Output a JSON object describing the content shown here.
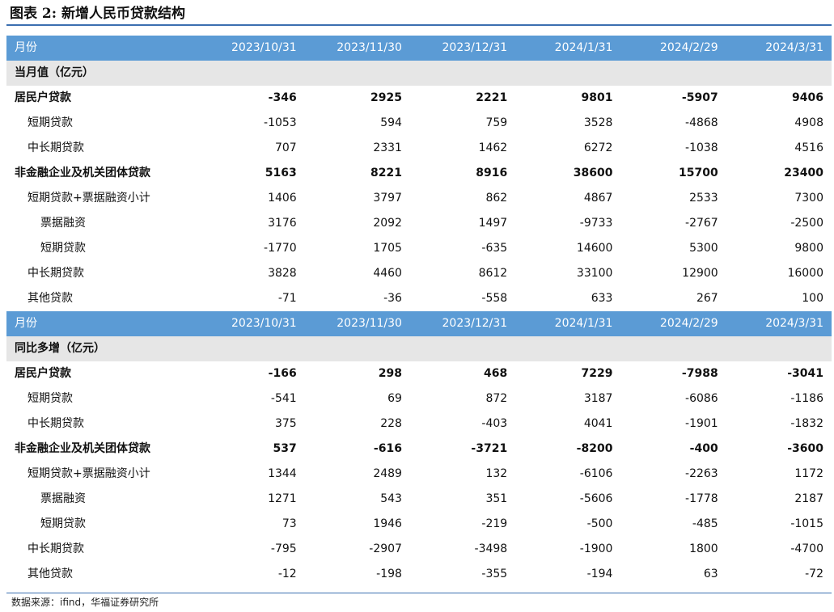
{
  "title": "图表 2:  新增人民币贷款结构",
  "columns_label": "月份",
  "columns": [
    "2023/10/31",
    "2023/11/30",
    "2023/12/31",
    "2024/1/31",
    "2024/2/29",
    "2024/3/31"
  ],
  "section1": {
    "label": "当月值（亿元）",
    "rows": [
      {
        "label": "居民户贷款",
        "values": [
          "-346",
          "2925",
          "2221",
          "9801",
          "-5907",
          "9406"
        ]
      },
      {
        "label": "短期贷款",
        "values": [
          "-1053",
          "594",
          "759",
          "3528",
          "-4868",
          "4908"
        ]
      },
      {
        "label": "中长期贷款",
        "values": [
          "707",
          "2331",
          "1462",
          "6272",
          "-1038",
          "4516"
        ]
      },
      {
        "label": "非金融企业及机关团体贷款",
        "values": [
          "5163",
          "8221",
          "8916",
          "38600",
          "15700",
          "23400"
        ]
      },
      {
        "label": "短期贷款+票据融资小计",
        "values": [
          "1406",
          "3797",
          "862",
          "4867",
          "2533",
          "7300"
        ]
      },
      {
        "label": "票据融资",
        "values": [
          "3176",
          "2092",
          "1497",
          "-9733",
          "-2767",
          "-2500"
        ]
      },
      {
        "label": "短期贷款",
        "values": [
          "-1770",
          "1705",
          "-635",
          "14600",
          "5300",
          "9800"
        ]
      },
      {
        "label": "中长期贷款",
        "values": [
          "3828",
          "4460",
          "8612",
          "33100",
          "12900",
          "16000"
        ]
      },
      {
        "label": "其他贷款",
        "values": [
          "-71",
          "-36",
          "-558",
          "633",
          "267",
          "100"
        ]
      }
    ]
  },
  "section2": {
    "label": "同比多增（亿元）",
    "rows": [
      {
        "label": "居民户贷款",
        "values": [
          "-166",
          "298",
          "468",
          "7229",
          "-7988",
          "-3041"
        ]
      },
      {
        "label": "短期贷款",
        "values": [
          "-541",
          "69",
          "872",
          "3187",
          "-6086",
          "-1186"
        ]
      },
      {
        "label": "中长期贷款",
        "values": [
          "375",
          "228",
          "-403",
          "4041",
          "-1901",
          "-1832"
        ]
      },
      {
        "label": "非金融企业及机关团体贷款",
        "values": [
          "537",
          "-616",
          "-3721",
          "-8200",
          "-400",
          "-3600"
        ]
      },
      {
        "label": "短期贷款+票据融资小计",
        "values": [
          "1344",
          "2489",
          "132",
          "-6106",
          "-2263",
          "1172"
        ]
      },
      {
        "label": "票据融资",
        "values": [
          "1271",
          "543",
          "351",
          "-5606",
          "-1778",
          "2187"
        ]
      },
      {
        "label": "短期贷款",
        "values": [
          "73",
          "1946",
          "-219",
          "-500",
          "-485",
          "-1015"
        ]
      },
      {
        "label": "中长期贷款",
        "values": [
          "-795",
          "-2907",
          "-3498",
          "-1900",
          "1800",
          "-4700"
        ]
      },
      {
        "label": "其他贷款",
        "values": [
          "-12",
          "-198",
          "-355",
          "-194",
          "63",
          "-72"
        ]
      }
    ]
  },
  "source": "数据来源：ifind，华福证券研究所"
}
